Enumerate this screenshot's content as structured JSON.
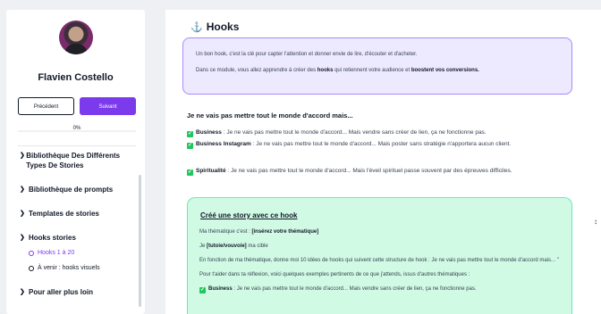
{
  "sidebar": {
    "name": "Flavien Costello",
    "prev_label": "Précédent",
    "next_label": "Suivant",
    "progress_text": "0%",
    "progress_value": 0,
    "items": [
      {
        "label": "Bibliothèque Des Différents Types De Stories"
      },
      {
        "label": "Bibliothèque de prompts"
      },
      {
        "label": "Templates de stories"
      },
      {
        "label": "Hooks stories"
      },
      {
        "label": "Pour aller plus loin"
      }
    ],
    "subitems": [
      {
        "label": "Hooks 1 à 20"
      },
      {
        "label": "À venir : hooks visuels"
      }
    ]
  },
  "main": {
    "title": "Hooks",
    "intro": {
      "p1": "Un bon hook, c'est la clé pour capter l'attention et donner envie de lire, d'écouter et d'acheter.",
      "p2_a": "Dans ce module, vous allez apprendre à créer des ",
      "p2_b": "hooks",
      "p2_c": " qui retiennent votre audience et ",
      "p2_d": "boostent vos conversions."
    },
    "section_heading": "Je ne vais pas mettre tout le monde d'accord mais...",
    "bullets": [
      {
        "label": "Business",
        "text": " : Je ne vais pas mettre tout le monde d'accord... Mais vendre sans créer de lien, ça ne fonctionne pas."
      },
      {
        "label": "Business Instagram",
        "text": " : Je ne vais pas mettre tout le monde d'accord... Mais poster sans stratégie n'apportera aucun client."
      },
      {
        "label": "Spiritualité",
        "text": " : Je ne vais pas mettre tout le monde d'accord... Mais l'éveil spirituel passe souvent par des épreuves difficiles."
      }
    ],
    "story": {
      "title": "Créé une story avec ce hook",
      "line1_a": "Ma thématique c'est : ",
      "line1_b": "[insérez votre thématique]",
      "line2_a": "Je ",
      "line2_b": "[tutoie/vouvoie]",
      "line2_c": " ma cible",
      "line3": "En fonction de ma thématique, donne moi 10 idées de hooks qui suivent cette structure de hook : Je ne vais pas mettre tout le monde d'accord mais... \"",
      "line4": "Pour t'aider dans ta réflexion, voici quelques exemples pertinents de ce que j'attends, issus d'autres thématiques :",
      "line5_label": "Business",
      "line5_text": " : Je ne vais pas mettre tout le monde d'accord... Mais vendre sans créer de lien, ça ne fonctionne pas."
    }
  },
  "icons": {
    "title_icon": "hook-icon",
    "check_icon": "check-icon",
    "chevron_icon": "chevron-down-icon",
    "corner_icon": "resize-icon"
  },
  "colors": {
    "accent": "#7c3aed",
    "intro_bg": "#ede9fe",
    "story_bg": "#d1fae5",
    "check": "#22c55e"
  }
}
